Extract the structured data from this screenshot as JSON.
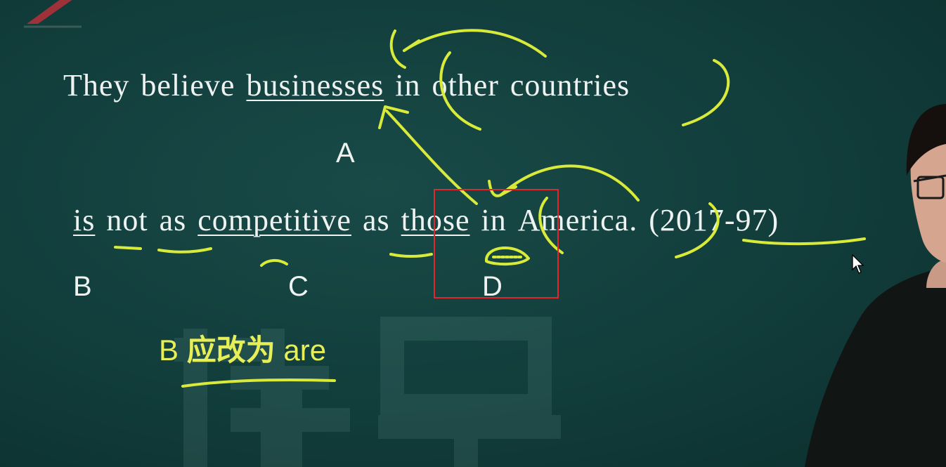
{
  "sentence": {
    "line1": {
      "w1": "They",
      "w2": "believe",
      "w3_underlined": "businesses",
      "w4": "in",
      "w5": "other",
      "w6": "countries"
    },
    "line2": {
      "w1_underlined": "is",
      "w2": "not",
      "w3": "as",
      "w4_underlined": "competitive",
      "w5": "as",
      "w6_underlined": "those",
      "w7": "in",
      "w8": "America.",
      "source": "(2017-97)"
    }
  },
  "option_labels": {
    "a": "A",
    "b": "B",
    "c": "C",
    "d": "D"
  },
  "answer_note": {
    "prefix": "B",
    "chinese": "应改为",
    "suffix": "are"
  },
  "colors": {
    "board": "#113d3b",
    "chalk_text": "#eef3f2",
    "annotation_yellow": "#d8ea3a",
    "highlight_box": "#e3262c"
  },
  "icons": [
    "logo-mark-icon",
    "mouse-cursor-icon",
    "watermark-logo-icon"
  ]
}
